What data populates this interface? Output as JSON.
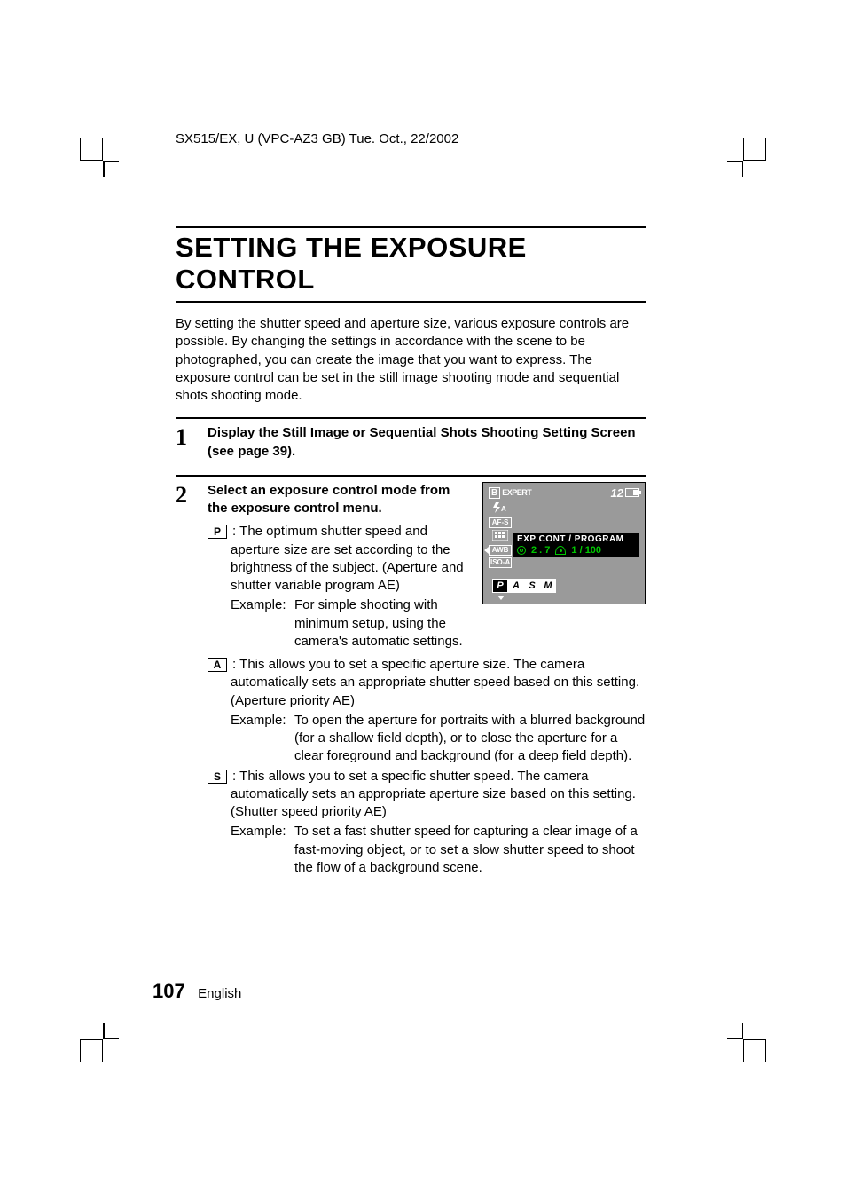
{
  "header": "SX515/EX, U (VPC-AZ3 GB)    Tue. Oct., 22/2002",
  "title": "SETTING THE EXPOSURE CONTROL",
  "intro": "By setting the shutter speed and aperture size, various exposure controls are possible. By changing the settings in accordance with the scene to be photographed, you can create the image that you want to express. The exposure control can be set in the still image shooting mode and sequential shots shooting mode.",
  "step1": {
    "num": "1",
    "title": "Display the Still Image or Sequential Shots Shooting Setting Screen (see page 39)."
  },
  "step2": {
    "num": "2",
    "title": "Select an exposure control mode from the exposure control menu.",
    "modes": {
      "p": {
        "letter": "P",
        "desc": "The optimum shutter speed and aperture size are set according to the brightness of the subject. (Aperture and shutter variable program AE)",
        "example_label": "Example:",
        "example": "For simple shooting with minimum setup, using the camera's automatic settings."
      },
      "a": {
        "letter": "A",
        "desc": "This allows you to set a specific aperture size. The camera automatically sets an appropriate shutter speed based on this setting. (Aperture priority AE)",
        "example_label": "Example:",
        "example": "To open the aperture for portraits with a blurred background (for a shallow field depth), or to close the aperture for a clear foreground and background (for a deep field depth)."
      },
      "s": {
        "letter": "S",
        "desc": "This allows you to set a specific shutter speed. The camera automatically sets an appropriate aperture size based on this setting. (Shutter speed priority AE)",
        "example_label": "Example:",
        "example": "To set a fast shutter speed for capturing a clear image of a fast-moving object, or to set a slow shutter speed to shoot the flow of a background scene."
      }
    }
  },
  "lcd": {
    "b": "B",
    "expert": "EXPERT",
    "count": "12",
    "afs": "AF-S",
    "awb": "AWB",
    "iso": "ISO-A",
    "exp_header": "EXP  CONT / PROGRAM",
    "aperture": "2 . 7",
    "shutter": "1 / 100",
    "p": "P",
    "a": "A",
    "s": "S",
    "m": "M"
  },
  "footer": {
    "page": "107",
    "lang": "English"
  }
}
